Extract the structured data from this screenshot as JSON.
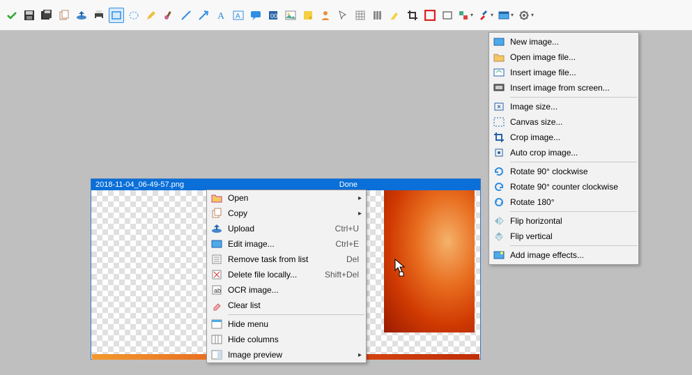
{
  "file": {
    "name": "2018-11-04_06-49-57.png",
    "status": "Done"
  },
  "context_menu": [
    {
      "icon": "folder-open",
      "label": "Open",
      "sub": true
    },
    {
      "icon": "copy",
      "label": "Copy",
      "sub": true
    },
    {
      "icon": "upload",
      "label": "Upload",
      "shortcut": "Ctrl+U"
    },
    {
      "icon": "edit",
      "label": "Edit image...",
      "shortcut": "Ctrl+E"
    },
    {
      "icon": "remove",
      "label": "Remove task from list",
      "shortcut": "Del"
    },
    {
      "icon": "delete",
      "label": "Delete file locally...",
      "shortcut": "Shift+Del"
    },
    {
      "icon": "ocr",
      "label": "OCR image..."
    },
    {
      "icon": "eraser",
      "label": "Clear list"
    },
    {
      "sep": true
    },
    {
      "icon": "panel",
      "label": "Hide menu"
    },
    {
      "icon": "columns",
      "label": "Hide columns"
    },
    {
      "icon": "preview",
      "label": "Image preview",
      "sub": true
    }
  ],
  "image_menu": [
    {
      "icon": "new",
      "label": "New image..."
    },
    {
      "icon": "open",
      "label": "Open image file..."
    },
    {
      "icon": "insert",
      "label": "Insert image file..."
    },
    {
      "icon": "screen",
      "label": "Insert image from screen..."
    },
    {
      "sep": true
    },
    {
      "icon": "size",
      "label": "Image size..."
    },
    {
      "icon": "canvas",
      "label": "Canvas size..."
    },
    {
      "icon": "crop",
      "label": "Crop image..."
    },
    {
      "icon": "autocrop",
      "label": "Auto crop image..."
    },
    {
      "sep": true
    },
    {
      "icon": "rotcw",
      "label": "Rotate 90° clockwise"
    },
    {
      "icon": "rotccw",
      "label": "Rotate 90° counter clockwise"
    },
    {
      "icon": "rot180",
      "label": "Rotate 180°"
    },
    {
      "sep": true
    },
    {
      "icon": "fliph",
      "label": "Flip horizontal"
    },
    {
      "icon": "flipv",
      "label": "Flip vertical"
    },
    {
      "sep": true
    },
    {
      "icon": "effects",
      "label": "Add image effects..."
    }
  ],
  "toolbar": [
    "check",
    "save",
    "save-all",
    "copy",
    "upload",
    "print",
    "rect-select",
    "ellipse-select",
    "pencil",
    "brush",
    "line",
    "arrow",
    "text",
    "text-box",
    "speech",
    "step",
    "hand",
    "person",
    "cursor",
    "grid",
    "columns",
    "highlight",
    "crop",
    "target",
    "rect",
    "swatch",
    "tools",
    "image-dd",
    "gear-dd"
  ]
}
